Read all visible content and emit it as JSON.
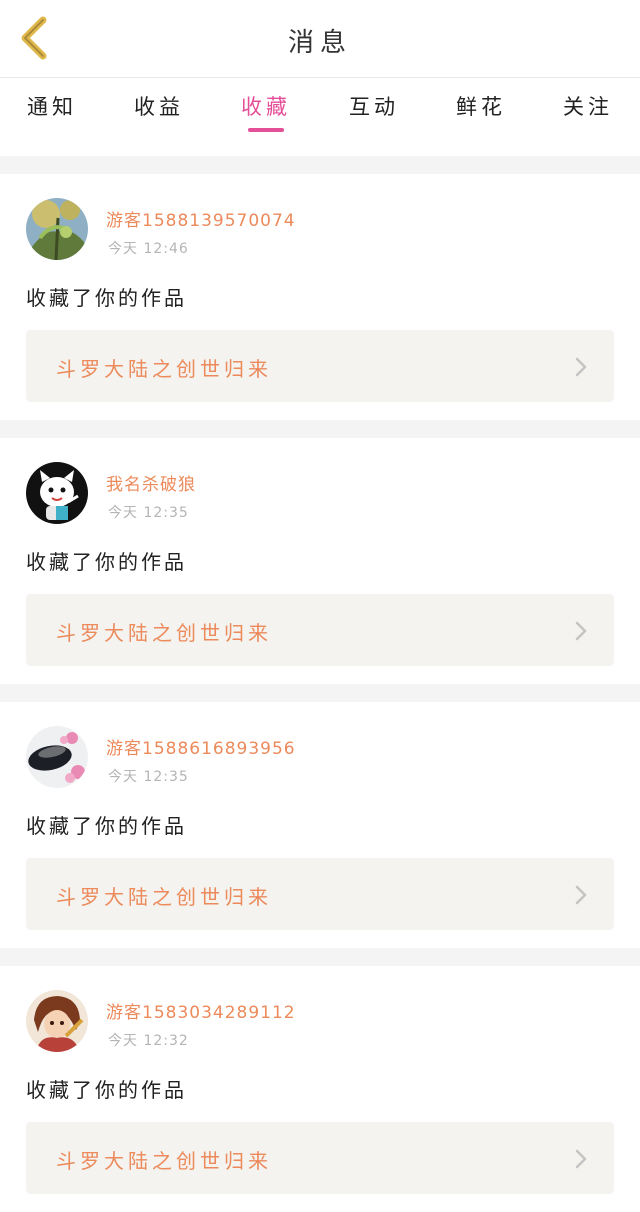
{
  "header": {
    "title": "消息"
  },
  "tabs": [
    {
      "label": "通知",
      "active": false
    },
    {
      "label": "收益",
      "active": false
    },
    {
      "label": "收藏",
      "active": true
    },
    {
      "label": "互动",
      "active": false
    },
    {
      "label": "鲜花",
      "active": false
    },
    {
      "label": "关注",
      "active": false
    }
  ],
  "messages": [
    {
      "username": "游客15881395700​74",
      "time": "今天 12:46",
      "action": "收藏了你的作品",
      "work_title": "斗罗大陆之创世归来"
    },
    {
      "username": "我名杀破狼",
      "time": "今天 12:35",
      "action": "收藏了你的作品",
      "work_title": "斗罗大陆之创世归来"
    },
    {
      "username": "游客15886168939​56",
      "time": "今天 12:35",
      "action": "收藏了你的作品",
      "work_title": "斗罗大陆之创世归来"
    },
    {
      "username": "游客15830342891​12",
      "time": "今天 12:32",
      "action": "收藏了你的作品",
      "work_title": "斗罗大陆之创世归来"
    }
  ],
  "colors": {
    "accent_pink": "#e54f98",
    "username_orange": "#ec8a5b",
    "back_arrow_gold": "#e0b84c"
  }
}
